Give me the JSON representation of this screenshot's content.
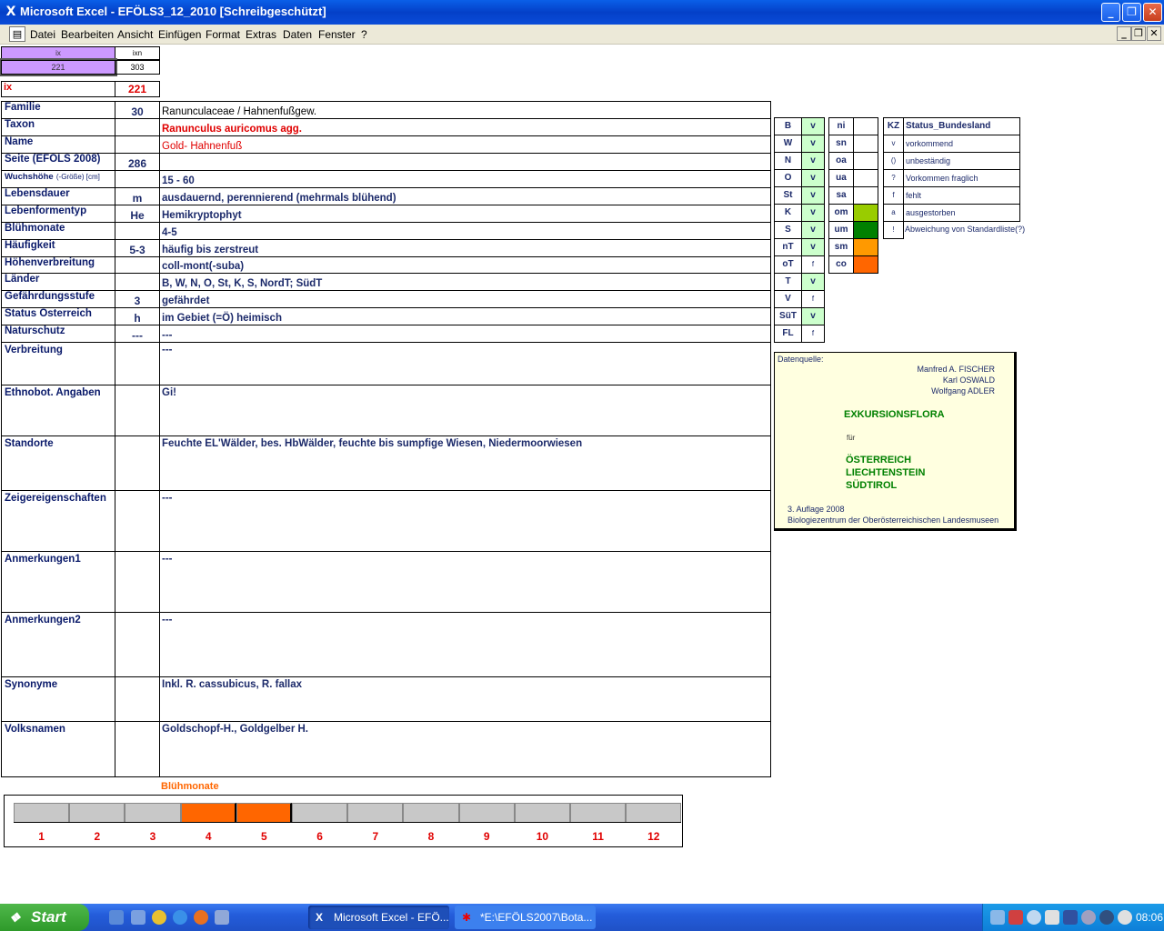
{
  "window": {
    "title": "Microsoft Excel - EFÖLS3_12_2010  [Schreibgeschützt]"
  },
  "menu": [
    "Datei",
    "Bearbeiten",
    "Ansicht",
    "Einfügen",
    "Format",
    "Extras",
    "Daten",
    "Fenster",
    "?"
  ],
  "topcells": {
    "h1": "ix",
    "h2": "ixn",
    "v1": "221",
    "v2": "303",
    "ix_label": "ix",
    "ix_value": "221"
  },
  "rows": [
    {
      "label": "Familie",
      "code": "30",
      "value": "Ranunculaceae  /  Hahnenfußgew."
    },
    {
      "label": "Taxon",
      "code": "",
      "value": "Ranunculus auricomus agg."
    },
    {
      "label": "Name",
      "code": "",
      "value": "Gold- Hahnenfuß"
    },
    {
      "label": "Seite (EFÖLS 2008)",
      "code": "286",
      "value": ""
    },
    {
      "label": "Wuchshöhe",
      "label_suffix": "(-Größe) [cm]",
      "code": "",
      "value": " 15 - 60"
    },
    {
      "label": "Lebensdauer",
      "code": "m",
      "value": "ausdauernd, perennierend (mehrmals blühend)"
    },
    {
      "label": "Lebenformentyp",
      "code": "He",
      "value": "Hemikryptophyt"
    },
    {
      "label": "Blühmonate",
      "code": "",
      "value": " 4-5"
    },
    {
      "label": "Häufigkeit",
      "code": "5-3",
      "value": "häufig bis zerstreut"
    },
    {
      "label": "Höhenverbreitung",
      "code": "",
      "value": "coll-mont(-suba)"
    },
    {
      "label": "Länder",
      "code": "",
      "value": "B, W, N, O, St, K, S, NordT; SüdT"
    },
    {
      "label": "Gefährdungsstufe",
      "code": "3",
      "value": "gefährdet"
    },
    {
      "label": "Status Österreich",
      "code": "h",
      "value": "im Gebiet (=Ö) heimisch"
    },
    {
      "label": "Naturschutz",
      "code": "---",
      "value": " ---"
    }
  ],
  "bigrows": [
    {
      "label": "Verbreitung",
      "value": " ---"
    },
    {
      "label": "Ethnobot. Angaben",
      "value": "Gi!"
    },
    {
      "label": "Standorte",
      "value": "Feuchte EL'Wälder, bes. HbWälder, feuchte bis sumpfige Wiesen, Niedermoorwiesen"
    },
    {
      "label": "Zeigereigenschaften",
      "value": "---"
    },
    {
      "label": "Anmerkungen1",
      "value": "---"
    },
    {
      "label": "Anmerkungen2",
      "value": "---"
    },
    {
      "label": "Synonyme",
      "value": "Inkl. R. cassubicus, R. fallax"
    },
    {
      "label": "Volksnamen",
      "value": "Goldschopf-H., Goldgelber H."
    }
  ],
  "laender": [
    {
      "k": "B",
      "v": "v"
    },
    {
      "k": "W",
      "v": "v"
    },
    {
      "k": "N",
      "v": "v"
    },
    {
      "k": "O",
      "v": "v"
    },
    {
      "k": "St",
      "v": "v"
    },
    {
      "k": "K",
      "v": "v"
    },
    {
      "k": "S",
      "v": "v"
    },
    {
      "k": "nT",
      "v": "v"
    },
    {
      "k": "oT",
      "v": "f"
    },
    {
      "k": "T",
      "v": "v"
    },
    {
      "k": "V",
      "v": "f"
    },
    {
      "k": "SüT",
      "v": "v"
    },
    {
      "k": "FL",
      "v": "f"
    }
  ],
  "hoehen": [
    {
      "k": "ni",
      "color": "#ffffff"
    },
    {
      "k": "sn",
      "color": "#ffffff"
    },
    {
      "k": "oa",
      "color": "#ffffff"
    },
    {
      "k": "ua",
      "color": "#ffffff"
    },
    {
      "k": "sa",
      "color": "#ffffff"
    },
    {
      "k": "om",
      "color": "#99cc00"
    },
    {
      "k": "um",
      "color": "#008000"
    },
    {
      "k": "sm",
      "color": "#ff9900"
    },
    {
      "k": "co",
      "color": "#ff6600"
    }
  ],
  "status": {
    "header_k": "KZ",
    "header_v": "Status_Bundesland",
    "items": [
      {
        "k": "v",
        "v": "vorkommend"
      },
      {
        "k": "()",
        "v": "unbeständig"
      },
      {
        "k": "?",
        "v": "Vorkommen fraglich"
      },
      {
        "k": "f",
        "v": "fehlt"
      },
      {
        "k": "a",
        "v": "ausgestorben"
      },
      {
        "k": "!",
        "v": "Abweichung von Standardliste(?)"
      }
    ]
  },
  "quelle": {
    "label": "Datenquelle:",
    "authors": [
      "Manfred A. FISCHER",
      "Karl OSWALD",
      "Wolfgang ADLER"
    ],
    "title": "EXKURSIONSFLORA",
    "fuer": "für",
    "countries": [
      "ÖSTERREICH",
      "LIECHTENSTEIN",
      "SÜDTIROL"
    ],
    "edition": "3. Auflage 2008",
    "publisher": "Biologiezentrum der Oberösterreichischen Landesmuseen"
  },
  "bluehchart": {
    "title": "Blühmonate",
    "months": [
      "1",
      "2",
      "3",
      "4",
      "5",
      "6",
      "7",
      "8",
      "9",
      "10",
      "11",
      "12"
    ],
    "active": [
      4,
      5
    ]
  },
  "taskbar": {
    "start": "Start",
    "tasks": [
      "Microsoft Excel - EFÖ...",
      "*E:\\EFÖLS2007\\Bota..."
    ],
    "clock": "08:06"
  },
  "colors": {
    "label": "#0a1a6a",
    "taxon": "#e00000",
    "green_cell": "#ccffcc",
    "highlight": "#cc99ff",
    "chart_on": "#ff6600",
    "chart_off": "#c8c8c8"
  }
}
